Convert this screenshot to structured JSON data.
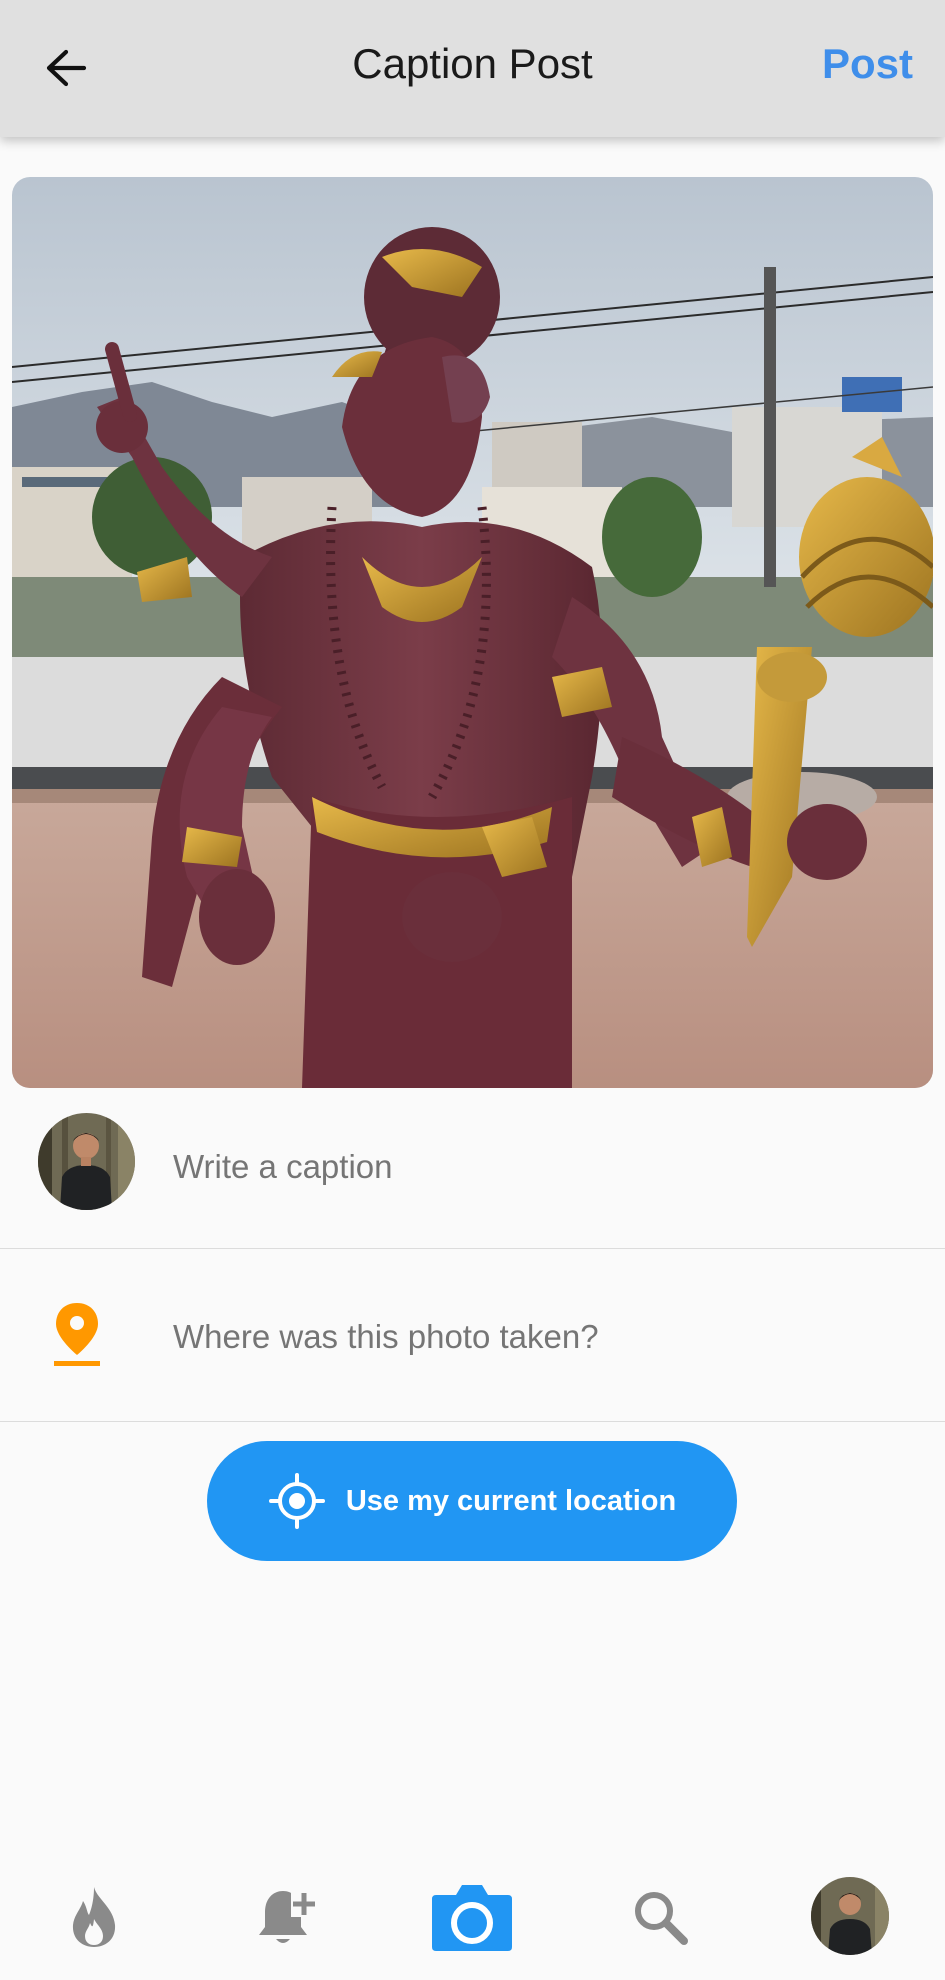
{
  "header": {
    "title": "Caption Post",
    "post_label": "Post"
  },
  "caption": {
    "placeholder": "Write a caption"
  },
  "location": {
    "placeholder": "Where was this photo taken?",
    "current_location_label": "Use my current location"
  },
  "colors": {
    "appbar_bg": "#e0e0e0",
    "accent": "#2196f3",
    "post_text": "#3f8eea",
    "pin": "#ff9800",
    "nav_icon": "#8a8a8a"
  },
  "bottom_nav": {
    "items": [
      {
        "icon": "flame-icon",
        "active": false
      },
      {
        "icon": "bell-plus-icon",
        "active": false
      },
      {
        "icon": "camera-icon",
        "active": true
      },
      {
        "icon": "search-icon",
        "active": false
      },
      {
        "icon": "profile-avatar",
        "active": false
      }
    ]
  }
}
